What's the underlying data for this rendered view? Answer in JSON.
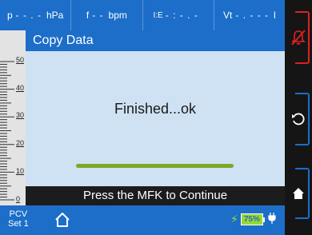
{
  "top_params": [
    {
      "value": "- - . -",
      "unit": "hPa",
      "prefix": "p"
    },
    {
      "value": "- -",
      "unit": "bpm",
      "prefix": "f"
    },
    {
      "value": "- : - . -",
      "unit": "",
      "prefix": "I:E"
    },
    {
      "value": "- . - - -",
      "unit": "l",
      "prefix": "Vt"
    }
  ],
  "scale_labels": [
    "50",
    "40",
    "30",
    "20",
    "10",
    "0"
  ],
  "dialog": {
    "title": "Copy Data",
    "status": "Finished...ok",
    "progress": 1.0
  },
  "message": "Press the MFK to Continue",
  "bottom": {
    "mode_line1": "PCV",
    "mode_line2": "Set 1",
    "battery_percent": "75%"
  },
  "colors": {
    "accent": "#1c6ec9",
    "panel": "#cfe2f3",
    "progress": "#7ea823",
    "alarm_key": "#e02020"
  }
}
